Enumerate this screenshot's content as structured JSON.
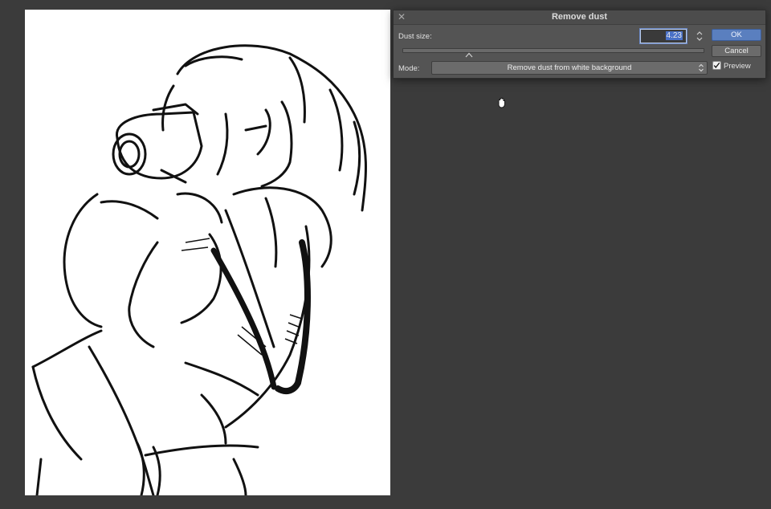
{
  "dialog": {
    "title": "Remove dust",
    "dust_size_label": "Dust size:",
    "dust_size_value": "4.23",
    "mode_label": "Mode:",
    "mode_value": "Remove dust from white background",
    "ok_label": "OK",
    "cancel_label": "Cancel",
    "preview_label": "Preview",
    "preview_checked": true,
    "slider_level_fraction": 0.22
  },
  "icons": {
    "close": "close-icon",
    "stepper": "stepper-arrows-icon",
    "select_arrows": "select-arrows-icon",
    "check": "checkmark-icon",
    "cursor": "grab-hand-icon"
  },
  "colors": {
    "workspace": "#3b3b3b",
    "dialog": "#545454",
    "accent": "#5a7fbf",
    "canvas": "#ffffff"
  }
}
